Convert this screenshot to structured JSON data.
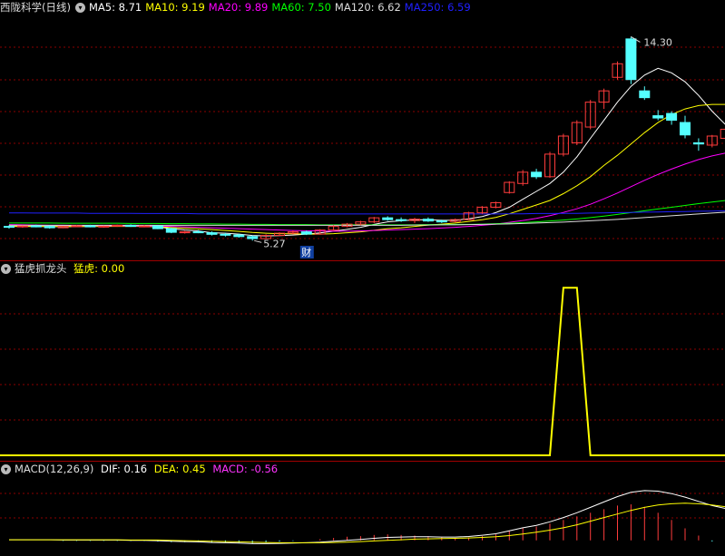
{
  "stock_title": "西陇科学(日线)",
  "indicators_main": [
    {
      "label": "MA5: 8.71",
      "color": "#ffffff"
    },
    {
      "label": "MA10: 9.19",
      "color": "#ffff00"
    },
    {
      "label": "MA20: 9.89",
      "color": "#ff00ff"
    },
    {
      "label": "MA60: 7.50",
      "color": "#00ff00"
    },
    {
      "label": "MA120: 6.62",
      "color": "#dddddd"
    },
    {
      "label": "MA250: 6.59",
      "color": "#2020ff"
    }
  ],
  "sub1": {
    "name": "猛虎抓龙头",
    "label": "猛虎: 0.00",
    "color": "#ffff00"
  },
  "sub2": {
    "name": "MACD(12,26,9)",
    "dif": "DIF: 0.16",
    "dea": "DEA: 0.45",
    "macd": "MACD: -0.56"
  },
  "annotations": {
    "high": "14.30",
    "low": "5.27",
    "event": "财"
  },
  "colors": {
    "up": "#ff3c3c",
    "down": "#54ffff",
    "grid": "#8b0000",
    "frame": "#a00000"
  },
  "chart_data": [
    {
      "type": "candlestick",
      "title": "西陇科学(日线)",
      "ylim": [
        4.6,
        15.2
      ],
      "candles": [
        [
          5.9,
          5.95,
          5.8,
          5.88
        ],
        [
          5.88,
          5.95,
          5.84,
          5.92
        ],
        [
          5.92,
          5.98,
          5.86,
          5.9
        ],
        [
          5.9,
          5.95,
          5.8,
          5.84
        ],
        [
          5.84,
          5.92,
          5.82,
          5.9
        ],
        [
          5.9,
          5.96,
          5.88,
          5.93
        ],
        [
          5.93,
          5.97,
          5.86,
          5.88
        ],
        [
          5.88,
          5.94,
          5.84,
          5.91
        ],
        [
          5.91,
          5.98,
          5.88,
          5.95
        ],
        [
          5.95,
          5.99,
          5.88,
          5.9
        ],
        [
          5.9,
          5.96,
          5.86,
          5.92
        ],
        [
          5.92,
          5.95,
          5.78,
          5.8
        ],
        [
          5.8,
          5.84,
          5.6,
          5.64
        ],
        [
          5.64,
          5.7,
          5.58,
          5.66
        ],
        [
          5.66,
          5.74,
          5.6,
          5.62
        ],
        [
          5.62,
          5.68,
          5.5,
          5.55
        ],
        [
          5.55,
          5.62,
          5.45,
          5.52
        ],
        [
          5.52,
          5.58,
          5.4,
          5.45
        ],
        [
          5.45,
          5.5,
          5.27,
          5.36
        ],
        [
          5.36,
          5.55,
          5.34,
          5.5
        ],
        [
          5.5,
          5.64,
          5.48,
          5.6
        ],
        [
          5.6,
          5.72,
          5.55,
          5.66
        ],
        [
          5.66,
          5.72,
          5.52,
          5.56
        ],
        [
          5.56,
          5.78,
          5.54,
          5.74
        ],
        [
          5.74,
          5.96,
          5.72,
          5.9
        ],
        [
          5.9,
          6.05,
          5.86,
          6.0
        ],
        [
          6.0,
          6.15,
          5.95,
          6.1
        ],
        [
          6.1,
          6.32,
          6.05,
          6.28
        ],
        [
          6.28,
          6.35,
          6.15,
          6.2
        ],
        [
          6.2,
          6.3,
          6.1,
          6.16
        ],
        [
          6.16,
          6.28,
          6.05,
          6.22
        ],
        [
          6.22,
          6.3,
          6.1,
          6.14
        ],
        [
          6.14,
          6.2,
          6.05,
          6.12
        ],
        [
          6.12,
          6.25,
          6.08,
          6.2
        ],
        [
          6.2,
          6.55,
          6.18,
          6.5
        ],
        [
          6.5,
          6.8,
          6.45,
          6.75
        ],
        [
          6.75,
          7.0,
          6.7,
          6.95
        ],
        [
          7.4,
          7.9,
          7.35,
          7.85
        ],
        [
          7.8,
          8.4,
          7.7,
          8.3
        ],
        [
          8.3,
          8.45,
          8.0,
          8.1
        ],
        [
          8.1,
          9.2,
          8.05,
          9.1
        ],
        [
          9.1,
          10.0,
          9.0,
          9.9
        ],
        [
          9.6,
          10.6,
          9.5,
          10.5
        ],
        [
          10.3,
          11.5,
          10.2,
          11.4
        ],
        [
          11.4,
          12.0,
          11.1,
          11.9
        ],
        [
          12.5,
          13.2,
          12.4,
          13.1
        ],
        [
          14.2,
          14.3,
          12.2,
          12.4
        ],
        [
          11.9,
          12.1,
          11.5,
          11.6
        ],
        [
          10.8,
          11.05,
          10.6,
          10.7
        ],
        [
          10.9,
          11.0,
          10.4,
          10.6
        ],
        [
          10.5,
          10.8,
          9.8,
          9.95
        ],
        [
          9.6,
          9.8,
          9.25,
          9.55
        ],
        [
          9.5,
          9.95,
          9.4,
          9.9
        ],
        [
          9.8,
          10.3,
          9.7,
          10.2
        ]
      ],
      "ma": [
        {
          "name": "MA5",
          "color": "#ffffff",
          "values": [
            5.9,
            5.9,
            5.9,
            5.89,
            5.89,
            5.89,
            5.9,
            5.9,
            5.91,
            5.91,
            5.91,
            5.88,
            5.8,
            5.74,
            5.7,
            5.62,
            5.6,
            5.56,
            5.5,
            5.48,
            5.49,
            5.52,
            5.56,
            5.61,
            5.69,
            5.77,
            5.86,
            5.99,
            6.1,
            6.15,
            6.19,
            6.2,
            6.17,
            6.17,
            6.24,
            6.34,
            6.51,
            6.75,
            7.1,
            7.45,
            7.8,
            8.3,
            8.98,
            9.8,
            10.6,
            11.4,
            12.1,
            12.6,
            12.9,
            12.7,
            12.3,
            11.7,
            11.0,
            10.4
          ]
        },
        {
          "name": "MA10",
          "color": "#ffff00",
          "values": [
            5.9,
            5.9,
            5.9,
            5.9,
            5.9,
            5.9,
            5.9,
            5.9,
            5.9,
            5.9,
            5.9,
            5.89,
            5.85,
            5.82,
            5.79,
            5.76,
            5.72,
            5.68,
            5.63,
            5.6,
            5.58,
            5.57,
            5.56,
            5.56,
            5.58,
            5.62,
            5.66,
            5.73,
            5.8,
            5.84,
            5.9,
            5.96,
            6.0,
            6.05,
            6.12,
            6.2,
            6.3,
            6.46,
            6.65,
            6.85,
            7.05,
            7.35,
            7.7,
            8.1,
            8.6,
            9.05,
            9.55,
            10.05,
            10.5,
            10.85,
            11.1,
            11.25,
            11.3,
            11.3
          ]
        },
        {
          "name": "MA20",
          "color": "#ff00ff",
          "values": [
            5.98,
            5.97,
            5.96,
            5.95,
            5.95,
            5.94,
            5.94,
            5.93,
            5.93,
            5.92,
            5.92,
            5.91,
            5.9,
            5.88,
            5.86,
            5.84,
            5.82,
            5.8,
            5.78,
            5.76,
            5.74,
            5.72,
            5.71,
            5.7,
            5.69,
            5.69,
            5.7,
            5.72,
            5.74,
            5.76,
            5.78,
            5.8,
            5.83,
            5.86,
            5.9,
            5.95,
            6.0,
            6.08,
            6.16,
            6.26,
            6.38,
            6.52,
            6.68,
            6.88,
            7.12,
            7.38,
            7.66,
            7.94,
            8.2,
            8.44,
            8.66,
            8.86,
            9.02,
            9.15
          ]
        },
        {
          "name": "MA60",
          "color": "#00ff00",
          "values": [
            6.05,
            6.05,
            6.05,
            6.05,
            6.04,
            6.04,
            6.04,
            6.04,
            6.04,
            6.03,
            6.03,
            6.03,
            6.02,
            6.02,
            6.01,
            6.01,
            6.0,
            6.0,
            5.99,
            5.99,
            5.98,
            5.98,
            5.98,
            5.97,
            5.97,
            5.97,
            5.97,
            5.97,
            5.97,
            5.97,
            5.97,
            5.98,
            5.98,
            5.99,
            5.99,
            6.0,
            6.02,
            6.04,
            6.07,
            6.1,
            6.14,
            6.18,
            6.23,
            6.29,
            6.36,
            6.43,
            6.51,
            6.59,
            6.67,
            6.75,
            6.83,
            6.91,
            6.98,
            7.05
          ]
        },
        {
          "name": "MA120",
          "color": "#dddddd",
          "values": [
            5.95,
            5.95,
            5.95,
            5.95,
            5.95,
            5.95,
            5.95,
            5.95,
            5.95,
            5.95,
            5.95,
            5.95,
            5.95,
            5.95,
            5.95,
            5.95,
            5.95,
            5.95,
            5.95,
            5.95,
            5.95,
            5.95,
            5.95,
            5.95,
            5.95,
            5.95,
            5.95,
            5.95,
            5.95,
            5.95,
            5.96,
            5.96,
            5.97,
            5.97,
            5.98,
            5.99,
            6.0,
            6.01,
            6.03,
            6.05,
            6.07,
            6.09,
            6.12,
            6.15,
            6.18,
            6.21,
            6.25,
            6.29,
            6.33,
            6.37,
            6.41,
            6.45,
            6.49,
            6.53
          ]
        },
        {
          "name": "MA250",
          "color": "#2020ff",
          "values": [
            6.5,
            6.5,
            6.49,
            6.49,
            6.49,
            6.49,
            6.48,
            6.48,
            6.48,
            6.48,
            6.47,
            6.47,
            6.47,
            6.47,
            6.46,
            6.46,
            6.46,
            6.46,
            6.45,
            6.45,
            6.45,
            6.45,
            6.45,
            6.45,
            6.45,
            6.45,
            6.45,
            6.45,
            6.45,
            6.45,
            6.45,
            6.45,
            6.45,
            6.45,
            6.45,
            6.45,
            6.45,
            6.46,
            6.46,
            6.47,
            6.47,
            6.48,
            6.48,
            6.49,
            6.5,
            6.51,
            6.52,
            6.53,
            6.54,
            6.55,
            6.56,
            6.57,
            6.58,
            6.59
          ]
        }
      ]
    },
    {
      "type": "line",
      "title": "猛虎抓龙头",
      "ylim": [
        0,
        1.05
      ],
      "series": [
        {
          "name": "猛虎",
          "color": "#ffff00",
          "values": [
            0,
            0,
            0,
            0,
            0,
            0,
            0,
            0,
            0,
            0,
            0,
            0,
            0,
            0,
            0,
            0,
            0,
            0,
            0,
            0,
            0,
            0,
            0,
            0,
            0,
            0,
            0,
            0,
            0,
            0,
            0,
            0,
            0,
            0,
            0,
            0,
            0,
            0,
            0,
            0,
            0,
            1,
            1,
            0,
            0,
            0,
            0,
            0,
            0,
            0,
            0,
            0,
            0,
            0
          ]
        }
      ]
    },
    {
      "type": "bar",
      "title": "MACD(12,26,9)",
      "ylim": [
        -0.4,
        2.2
      ],
      "series": [
        {
          "name": "DIF",
          "color": "#ffffff",
          "values": [
            0.02,
            0.02,
            0.02,
            0.02,
            0.01,
            0.01,
            0.01,
            0.01,
            0.01,
            0.0,
            0.0,
            -0.01,
            -0.03,
            -0.04,
            -0.05,
            -0.07,
            -0.08,
            -0.09,
            -0.11,
            -0.11,
            -0.1,
            -0.09,
            -0.08,
            -0.06,
            -0.03,
            0.0,
            0.03,
            0.07,
            0.1,
            0.11,
            0.12,
            0.12,
            0.11,
            0.11,
            0.13,
            0.17,
            0.22,
            0.32,
            0.42,
            0.5,
            0.62,
            0.76,
            0.92,
            1.1,
            1.28,
            1.46,
            1.6,
            1.66,
            1.64,
            1.56,
            1.44,
            1.3,
            1.16,
            1.06
          ]
        },
        {
          "name": "DEA",
          "color": "#ffff00",
          "values": [
            0.02,
            0.02,
            0.02,
            0.02,
            0.02,
            0.02,
            0.02,
            0.02,
            0.02,
            0.01,
            0.01,
            0.01,
            0.0,
            -0.01,
            -0.02,
            -0.03,
            -0.04,
            -0.05,
            -0.06,
            -0.07,
            -0.08,
            -0.08,
            -0.08,
            -0.08,
            -0.07,
            -0.06,
            -0.04,
            -0.02,
            0.0,
            0.02,
            0.04,
            0.05,
            0.06,
            0.07,
            0.08,
            0.1,
            0.12,
            0.16,
            0.21,
            0.27,
            0.34,
            0.42,
            0.52,
            0.64,
            0.76,
            0.88,
            1.0,
            1.1,
            1.18,
            1.22,
            1.24,
            1.22,
            1.18,
            1.12
          ]
        },
        {
          "name": "MACD",
          "values": [
            0.0,
            0.0,
            0.0,
            0.0,
            -0.02,
            -0.02,
            -0.02,
            -0.02,
            -0.02,
            -0.02,
            -0.02,
            -0.04,
            -0.06,
            -0.06,
            -0.06,
            -0.08,
            -0.08,
            -0.08,
            -0.1,
            -0.08,
            -0.04,
            -0.02,
            0.0,
            0.04,
            0.08,
            0.12,
            0.14,
            0.18,
            0.2,
            0.18,
            0.16,
            0.14,
            0.1,
            0.08,
            0.1,
            0.14,
            0.2,
            0.32,
            0.42,
            0.46,
            0.56,
            0.68,
            0.8,
            0.92,
            1.04,
            1.16,
            1.2,
            1.12,
            0.92,
            0.68,
            0.4,
            0.16,
            -0.04,
            -0.12
          ]
        }
      ]
    }
  ]
}
